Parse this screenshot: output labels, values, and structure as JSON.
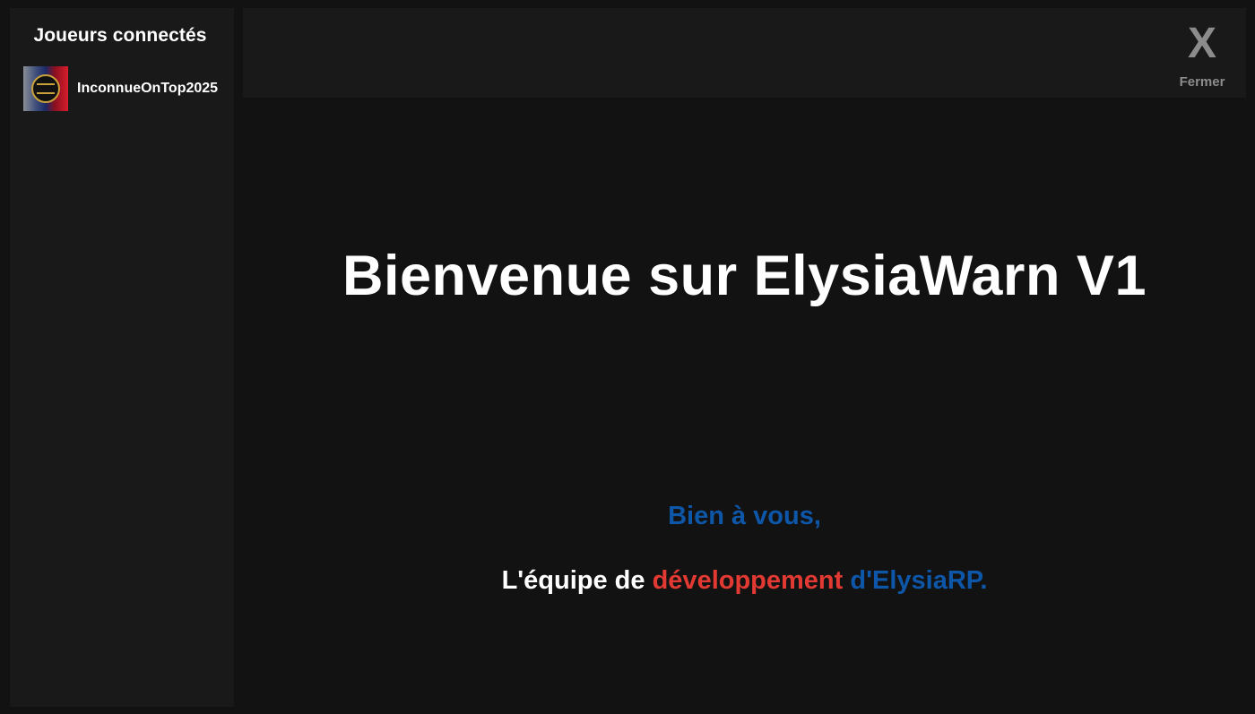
{
  "sidebar": {
    "title": "Joueurs connectés",
    "players": [
      {
        "name": "InconnueOnTop2025",
        "avatar_icon": "player-avatar"
      }
    ]
  },
  "header": {
    "close_icon": "X",
    "close_label": "Fermer"
  },
  "main": {
    "welcome_title": "Bienvenue sur ElysiaWarn V1",
    "greeting": "Bien à vous,",
    "signature": {
      "part1": "L'équipe de",
      "part2": "développement",
      "part3": "d'ElysiaRP."
    }
  },
  "colors": {
    "background": "#121212",
    "panel": "#191919",
    "text": "#ffffff",
    "muted": "#8c8c8c",
    "accent_blue": "#0e56a8",
    "accent_red": "#e23a33"
  }
}
